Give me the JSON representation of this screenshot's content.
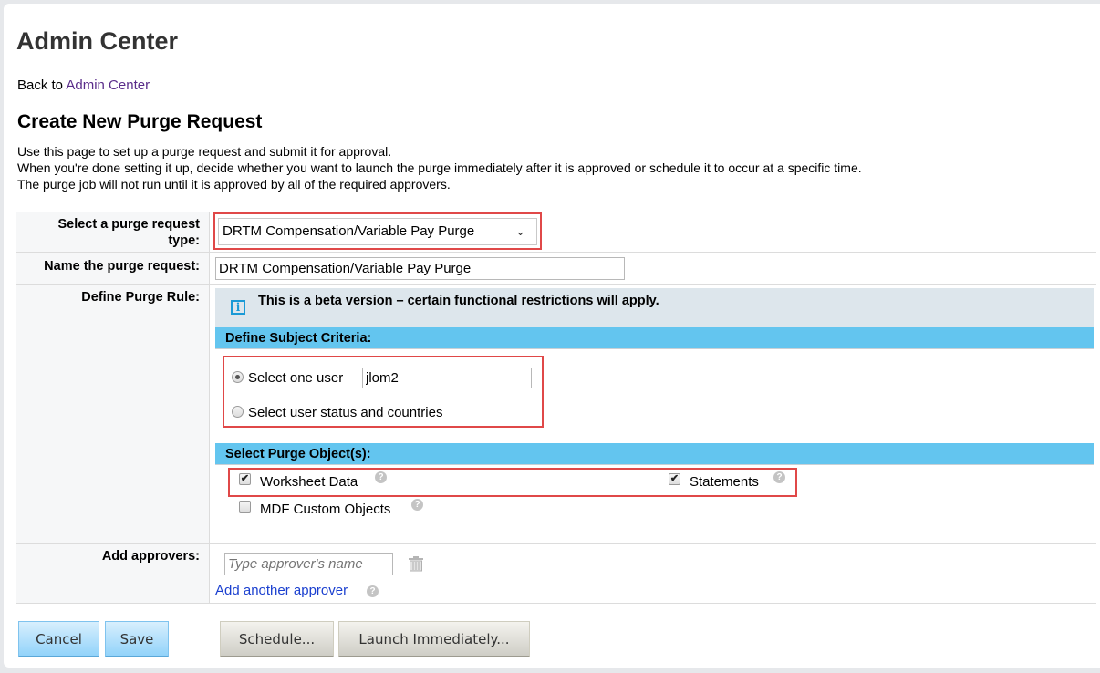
{
  "header": {
    "app_title": "Admin Center",
    "back_prefix": "Back to ",
    "back_link": "Admin Center"
  },
  "page": {
    "title": "Create New Purge Request",
    "intro": [
      "Use this page to set up a purge request and submit it for approval.",
      "When you're done setting it up, decide whether you want to launch the purge immediately after it is approved or schedule it to occur at a specific time.",
      "The purge job will not run until it is approved by all of the required approvers."
    ]
  },
  "form": {
    "type_label_line1": "Select a purge request",
    "type_label_line2": "type:",
    "type_selected": "DRTM Compensation/Variable Pay Purge",
    "name_label": "Name the purge request:",
    "name_value": "DRTM Compensation/Variable Pay Purge",
    "rule_label": "Define Purge Rule:",
    "beta_notice": "This is a beta version – certain functional restrictions will apply.",
    "subject_header": "Define Subject Criteria:",
    "subject_options": [
      {
        "label": "Select one user",
        "selected": true,
        "value": "jlom2"
      },
      {
        "label": "Select user status and countries",
        "selected": false
      }
    ],
    "objects_header": "Select Purge Object(s):",
    "objects": [
      {
        "label": "Worksheet Data",
        "checked": true
      },
      {
        "label": "Statements",
        "checked": true
      },
      {
        "label": "MDF Custom Objects",
        "checked": false
      }
    ],
    "approvers_label": "Add approvers:",
    "approver_placeholder": "Type approver's name",
    "add_approver_link": "Add another approver"
  },
  "buttons": {
    "cancel": "Cancel",
    "save": "Save",
    "schedule": "Schedule...",
    "launch": "Launch Immediately..."
  },
  "icons": {
    "info": "i",
    "help": "?",
    "check": "✔",
    "chevron": "⌄"
  },
  "colors": {
    "highlight": "#e04848",
    "section_bar": "#63c5ef",
    "link": "#1a3fcf"
  }
}
